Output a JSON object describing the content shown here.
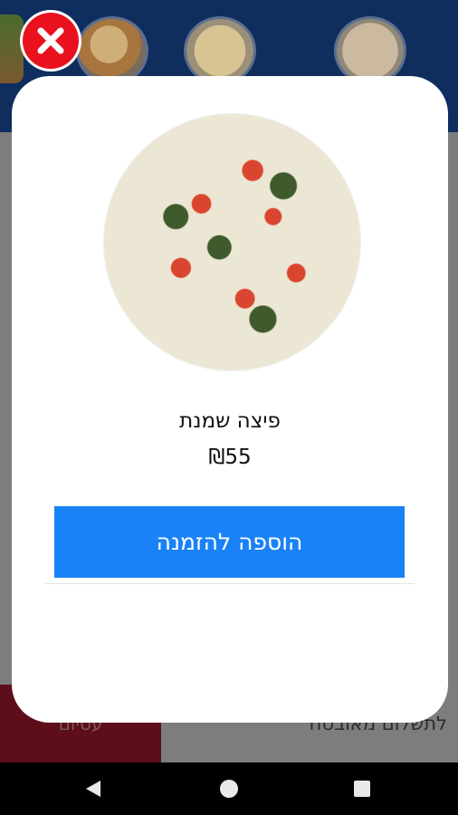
{
  "background_app": {
    "bottom_bar": {
      "left_label": "עסיום",
      "right_label": "לתשלום מאובטח"
    }
  },
  "modal": {
    "item_name": "פיצה שמנת",
    "item_price": "₪55",
    "add_button_label": "הוספה להזמנה",
    "add_button_color": "#1a82f7",
    "close_button_color": "#e8111d"
  },
  "icons": {
    "close": "close-icon",
    "back": "back-triangle-icon",
    "home": "home-circle-icon",
    "recent": "recent-square-icon"
  }
}
